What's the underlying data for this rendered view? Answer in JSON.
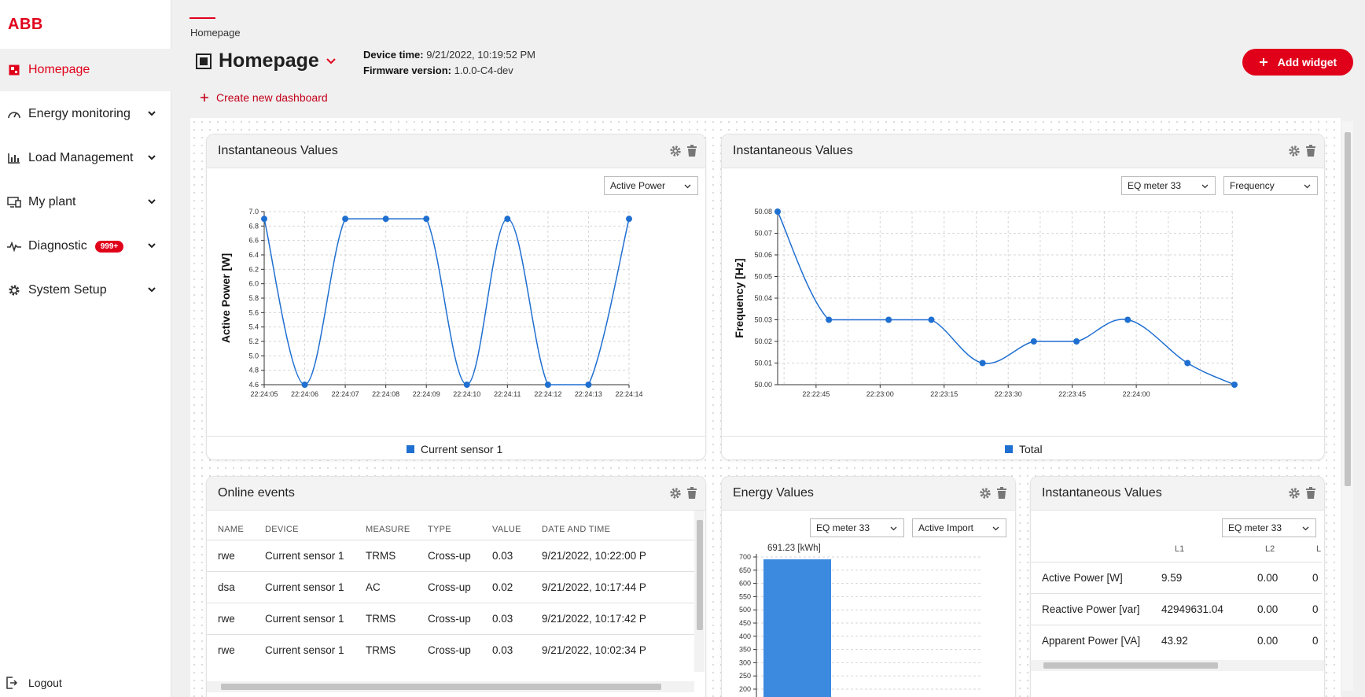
{
  "brand": {
    "logo_text": "ABB",
    "accent": "#e0001a"
  },
  "sidebar": {
    "items": [
      {
        "label": "Homepage",
        "icon": "dashboard-icon",
        "active": true
      },
      {
        "label": "Energy monitoring",
        "icon": "gauge-icon"
      },
      {
        "label": "Load Management",
        "icon": "bar-chart-icon"
      },
      {
        "label": "My plant",
        "icon": "devices-icon"
      },
      {
        "label": "Diagnostic",
        "icon": "pulse-icon",
        "badge": "999+"
      },
      {
        "label": "System Setup",
        "icon": "gear-icon"
      }
    ],
    "logout": "Logout"
  },
  "header": {
    "breadcrumb": "Homepage",
    "title": "Homepage",
    "device_time_label": "Device time:",
    "device_time": "9/21/2022, 10:19:52 PM",
    "firmware_label": "Firmware version:",
    "firmware": "1.0.0-C4-dev",
    "add_widget": "Add widget",
    "create_dashboard": "Create new dashboard"
  },
  "widgets": {
    "w1": {
      "title": "Instantaneous Values",
      "select": "Active Power",
      "legend": "Current sensor 1"
    },
    "w2": {
      "title": "Instantaneous Values",
      "select_meter": "EQ meter 33",
      "select_measure": "Frequency",
      "legend": "Total"
    },
    "events": {
      "title": "Online events",
      "columns": [
        "NAME",
        "DEVICE",
        "MEASURE",
        "TYPE",
        "VALUE",
        "DATE AND TIME"
      ],
      "rows": [
        [
          "rwe",
          "Current sensor 1",
          "TRMS",
          "Cross-up",
          "0.03",
          "9/21/2022, 10:22:00 P"
        ],
        [
          "dsa",
          "Current sensor 1",
          "AC",
          "Cross-up",
          "0.02",
          "9/21/2022, 10:17:44 P"
        ],
        [
          "rwe",
          "Current sensor 1",
          "TRMS",
          "Cross-up",
          "0.03",
          "9/21/2022, 10:17:42 P"
        ],
        [
          "rwe",
          "Current sensor 1",
          "TRMS",
          "Cross-up",
          "0.03",
          "9/21/2022, 10:02:34 P"
        ]
      ]
    },
    "energy": {
      "title": "Energy Values",
      "select_meter": "EQ meter 33",
      "select_measure": "Active Import",
      "bar_label": "691.23 [kWh]"
    },
    "iv3": {
      "title": "Instantaneous Values",
      "select_meter": "EQ meter 33",
      "columns": [
        "L1",
        "L2",
        "L"
      ],
      "rows": [
        [
          "Active Power [W]",
          "9.59",
          "0.00",
          "0"
        ],
        [
          "Reactive Power [var]",
          "42949631.04",
          "0.00",
          "0"
        ],
        [
          "Apparent Power [VA]",
          "43.92",
          "0.00",
          "0"
        ]
      ]
    }
  },
  "chart_data": [
    {
      "type": "line",
      "ylabel": "Active Power [W]",
      "ylim": [
        4.6,
        7.0
      ],
      "yticks": [
        "4.6",
        "4.8",
        "5.0",
        "5.2",
        "5.4",
        "5.6",
        "5.8",
        "6.0",
        "6.2",
        "6.4",
        "6.6",
        "6.8",
        "7.0"
      ],
      "x": [
        "22:24:05",
        "22:24:06",
        "22:24:07",
        "22:24:08",
        "22:24:09",
        "22:24:10",
        "22:24:11",
        "22:24:12",
        "22:24:13",
        "22:24:14"
      ],
      "series": [
        {
          "name": "Current sensor 1",
          "values": [
            6.9,
            4.6,
            6.9,
            6.9,
            6.9,
            4.6,
            6.9,
            4.6,
            4.6,
            6.9
          ]
        }
      ],
      "grid": true,
      "legend": "bottom"
    },
    {
      "type": "line",
      "ylabel": "Frequency [Hz]",
      "ylim": [
        50.0,
        50.08
      ],
      "yticks": [
        "50.00",
        "50.01",
        "50.02",
        "50.03",
        "50.04",
        "50.05",
        "50.06",
        "50.07",
        "50.08"
      ],
      "xticks": [
        "22:22:45",
        "22:23:00",
        "22:23:15",
        "22:23:30",
        "22:23:45",
        "22:24:00"
      ],
      "xrange_seconds": [
        36,
        143
      ],
      "series": [
        {
          "name": "Total",
          "t": [
            36,
            48,
            62,
            72,
            84,
            96,
            106,
            118,
            132,
            143
          ],
          "values": [
            50.08,
            50.03,
            50.03,
            50.03,
            50.01,
            50.02,
            50.02,
            50.03,
            50.01,
            50.0
          ]
        }
      ],
      "grid": true,
      "legend": "bottom"
    },
    {
      "type": "bar",
      "ylim": [
        200,
        700
      ],
      "yticks": [
        "200",
        "250",
        "300",
        "350",
        "400",
        "450",
        "500",
        "550",
        "600",
        "650",
        "700"
      ],
      "categories": [
        ""
      ],
      "values": [
        691.23
      ],
      "unit": "kWh"
    }
  ]
}
